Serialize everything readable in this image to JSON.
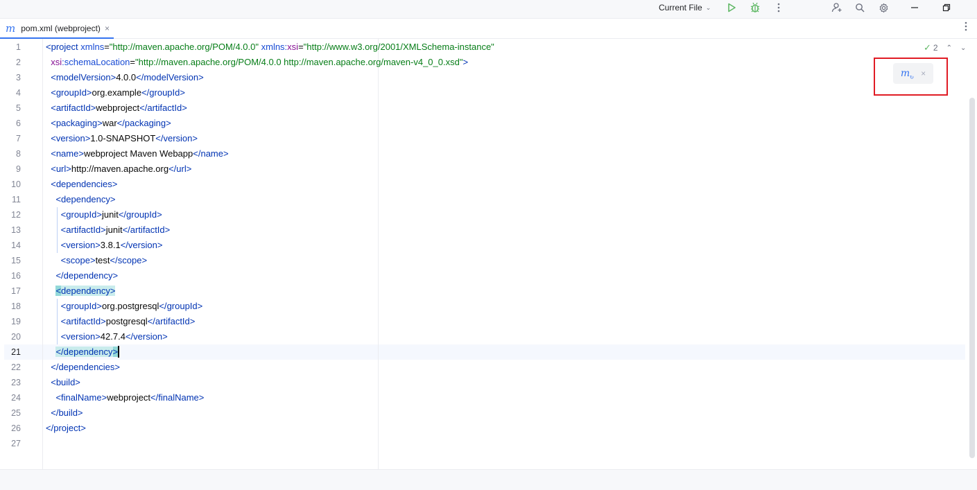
{
  "toolbar": {
    "run_config_label": "Current File",
    "icons": [
      "chevron-down-icon",
      "run-icon",
      "debug-icon",
      "more-vertical-icon",
      "add-user-icon",
      "search-icon",
      "gear-icon",
      "minimize-icon",
      "restore-icon"
    ],
    "run_color": "#5fb865"
  },
  "tab": {
    "file_label": "pom.xml (webproject)",
    "file_icon": "m",
    "close": "×"
  },
  "inspections": {
    "count": "2"
  },
  "maven_popup": {
    "icon": "m",
    "close": "×"
  },
  "editor": {
    "current_line": "21",
    "line_numbers": [
      "1",
      "2",
      "3",
      "4",
      "5",
      "6",
      "7",
      "8",
      "9",
      "10",
      "11",
      "12",
      "13",
      "14",
      "15",
      "16",
      "17",
      "18",
      "19",
      "20",
      "21",
      "22",
      "23",
      "24",
      "25",
      "26",
      "27"
    ],
    "lines": {
      "l1": {
        "t1": "<project",
        "a1": "xmlns",
        "v1": "\"http://maven.apache.org/POM/4.0.0\"",
        "a2": "xmlns:",
        "a3": "xsi",
        "v2": "\"http://www.w3.org/2001/XMLSchema-instance\""
      },
      "l2": {
        "a1": "xsi",
        "a2": ":schemaLocation",
        "v1": "\"http://maven.apache.org/POM/4.0.0 http://maven.apache.org/maven-v4_0_0.xsd\"",
        "end": ">"
      },
      "l3": {
        "open": "modelVersion",
        "text": "4.0.0",
        "close": "modelVersion"
      },
      "l4": {
        "open": "groupId",
        "text": "org.example",
        "close": "groupId"
      },
      "l5": {
        "open": "artifactId",
        "text": "webproject",
        "close": "artifactId"
      },
      "l6": {
        "open": "packaging",
        "text": "war",
        "close": "packaging"
      },
      "l7": {
        "open": "version",
        "text": "1.0-SNAPSHOT",
        "close": "version"
      },
      "l8": {
        "open": "name",
        "text": "webproject Maven Webapp",
        "close": "name"
      },
      "l9": {
        "open": "url",
        "text": "http://maven.apache.org",
        "close": "url"
      },
      "l10": {
        "open": "dependencies"
      },
      "l11": {
        "open": "dependency"
      },
      "l12": {
        "open": "groupId",
        "text": "junit",
        "close": "groupId"
      },
      "l13": {
        "open": "artifactId",
        "text": "junit",
        "close": "artifactId"
      },
      "l14": {
        "open": "version",
        "text": "3.8.1",
        "close": "version"
      },
      "l15": {
        "open": "scope",
        "text": "test",
        "close": "scope"
      },
      "l16": {
        "close": "dependency"
      },
      "l17": {
        "open": "dependency"
      },
      "l18": {
        "open": "groupId",
        "text": "org.postgresql",
        "close": "groupId"
      },
      "l19": {
        "open": "artifactId",
        "text": "postgresql",
        "close": "artifactId"
      },
      "l20": {
        "open": "version",
        "text": "42.7.4",
        "close": "version"
      },
      "l21": {
        "close": "dependency"
      },
      "l22": {
        "close": "dependencies"
      },
      "l23": {
        "open": "build"
      },
      "l24": {
        "open": "finalName",
        "text": "webproject",
        "close": "finalName"
      },
      "l25": {
        "close": "build"
      },
      "l26": {
        "close": "project"
      }
    }
  },
  "colors": {
    "tag": "#0033b3",
    "attr_value": "#067d17",
    "ns": "#871094",
    "accent": "#3574f0",
    "highlight": "#93d9d9",
    "annotation_box": "#e01b24"
  }
}
